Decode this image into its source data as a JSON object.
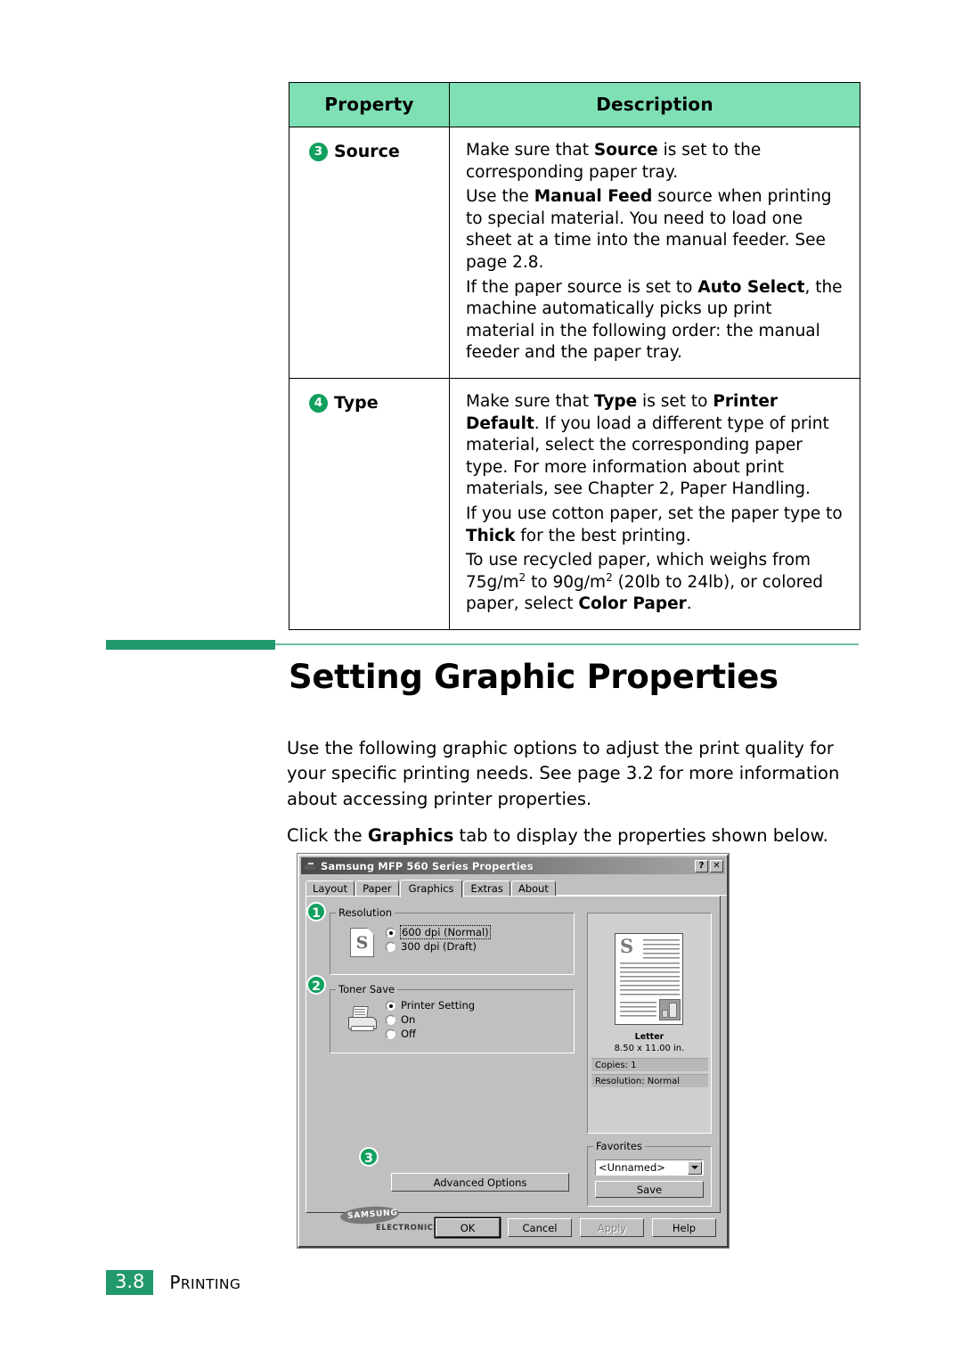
{
  "colors": {
    "header_green": "#7FE0B5",
    "accent_green": "#21996C",
    "marker_green": "#12A05F"
  },
  "table": {
    "headers": [
      "Property",
      "Description"
    ],
    "rows": [
      {
        "num": "3",
        "property": "Source",
        "paragraphs": [
          [
            {
              "t": "Make sure that ",
              "b": false
            },
            {
              "t": "Source",
              "b": true
            },
            {
              "t": " is set to the corresponding paper tray.",
              "b": false
            }
          ],
          [
            {
              "t": "Use the ",
              "b": false
            },
            {
              "t": "Manual Feed",
              "b": true
            },
            {
              "t": " source when printing to special material. You need to load one sheet at a time into the manual feeder. See page 2.8.",
              "b": false
            }
          ],
          [
            {
              "t": "If the paper source is set to ",
              "b": false
            },
            {
              "t": "Auto Select",
              "b": true
            },
            {
              "t": ", the machine automatically picks up print material in the following order: the manual feeder and the paper tray.",
              "b": false
            }
          ]
        ]
      },
      {
        "num": "4",
        "property": "Type",
        "paragraphs": [
          [
            {
              "t": "Make sure that ",
              "b": false
            },
            {
              "t": "Type",
              "b": true
            },
            {
              "t": " is set to ",
              "b": false
            },
            {
              "t": "Printer Default",
              "b": true
            },
            {
              "t": ". If you load a different type of print material, select the corresponding paper type. For more information about print materials, see Chapter 2, Paper Handling.",
              "b": false
            }
          ],
          [
            {
              "t": "If you use cotton paper, set the paper type to ",
              "b": false
            },
            {
              "t": "Thick",
              "b": true
            },
            {
              "t": " for the best printing.",
              "b": false
            }
          ],
          [
            {
              "t": "To use recycled paper, which weighs from 75g/m",
              "b": false,
              "sup": "2"
            },
            {
              "t": " to 90g/m",
              "b": false,
              "sup": "2"
            },
            {
              "t": " (20lb to 24lb), or colored paper, select ",
              "b": false
            },
            {
              "t": "Color Paper",
              "b": true
            },
            {
              "t": ".",
              "b": false
            }
          ]
        ]
      }
    ]
  },
  "heading": "Setting Graphic Properties",
  "paragraphs": {
    "intro": [
      {
        "t": "Use the following graphic options to adjust the print quality for your specific printing needs. See page 3.2 for more information about accessing printer properties.",
        "b": false
      }
    ],
    "instruction": [
      {
        "t": "Click the ",
        "b": false
      },
      {
        "t": "Graphics",
        "b": true
      },
      {
        "t": " tab to display the properties shown below.",
        "b": false
      }
    ]
  },
  "dialog": {
    "title": "Samsung MFP 560 Series Properties",
    "titlebar_buttons": [
      "?",
      "✕"
    ],
    "tabs": [
      {
        "label": "Layout",
        "active": false
      },
      {
        "label": "Paper",
        "active": false
      },
      {
        "label": "Graphics",
        "active": true
      },
      {
        "label": "Extras",
        "active": false
      },
      {
        "label": "About",
        "active": false
      }
    ],
    "resolution": {
      "group_label": "Resolution",
      "options": [
        {
          "label": "600 dpi (Normal)",
          "selected": true
        },
        {
          "label": "300 dpi (Draft)",
          "selected": false
        }
      ],
      "icon_letter": "S"
    },
    "toner_save": {
      "group_label": "Toner Save",
      "options": [
        {
          "label": "Printer Setting",
          "selected": true
        },
        {
          "label": "On",
          "selected": false
        },
        {
          "label": "Off",
          "selected": false
        }
      ]
    },
    "preview": {
      "paper_name": "Letter",
      "dimensions": "8.50 x 11.00 in.",
      "copies": "Copies: 1",
      "resolution": "Resolution: Normal",
      "page_letter": "S"
    },
    "favorites": {
      "group_label": "Favorites",
      "selected": "<Unnamed>",
      "save_label": "Save"
    },
    "advanced_label": "Advanced Options",
    "logo": {
      "brand": "SAMSUNG",
      "sub": "ELECTRONICS"
    },
    "footer_buttons": [
      {
        "label": "OK",
        "state": "default"
      },
      {
        "label": "Cancel",
        "state": "normal"
      },
      {
        "label": "Apply",
        "state": "disabled"
      },
      {
        "label": "Help",
        "state": "normal"
      }
    ],
    "markers": [
      "1",
      "2",
      "3"
    ]
  },
  "page_footer": {
    "number": "3.8",
    "section_first": "P",
    "section_rest": "RINTING"
  }
}
